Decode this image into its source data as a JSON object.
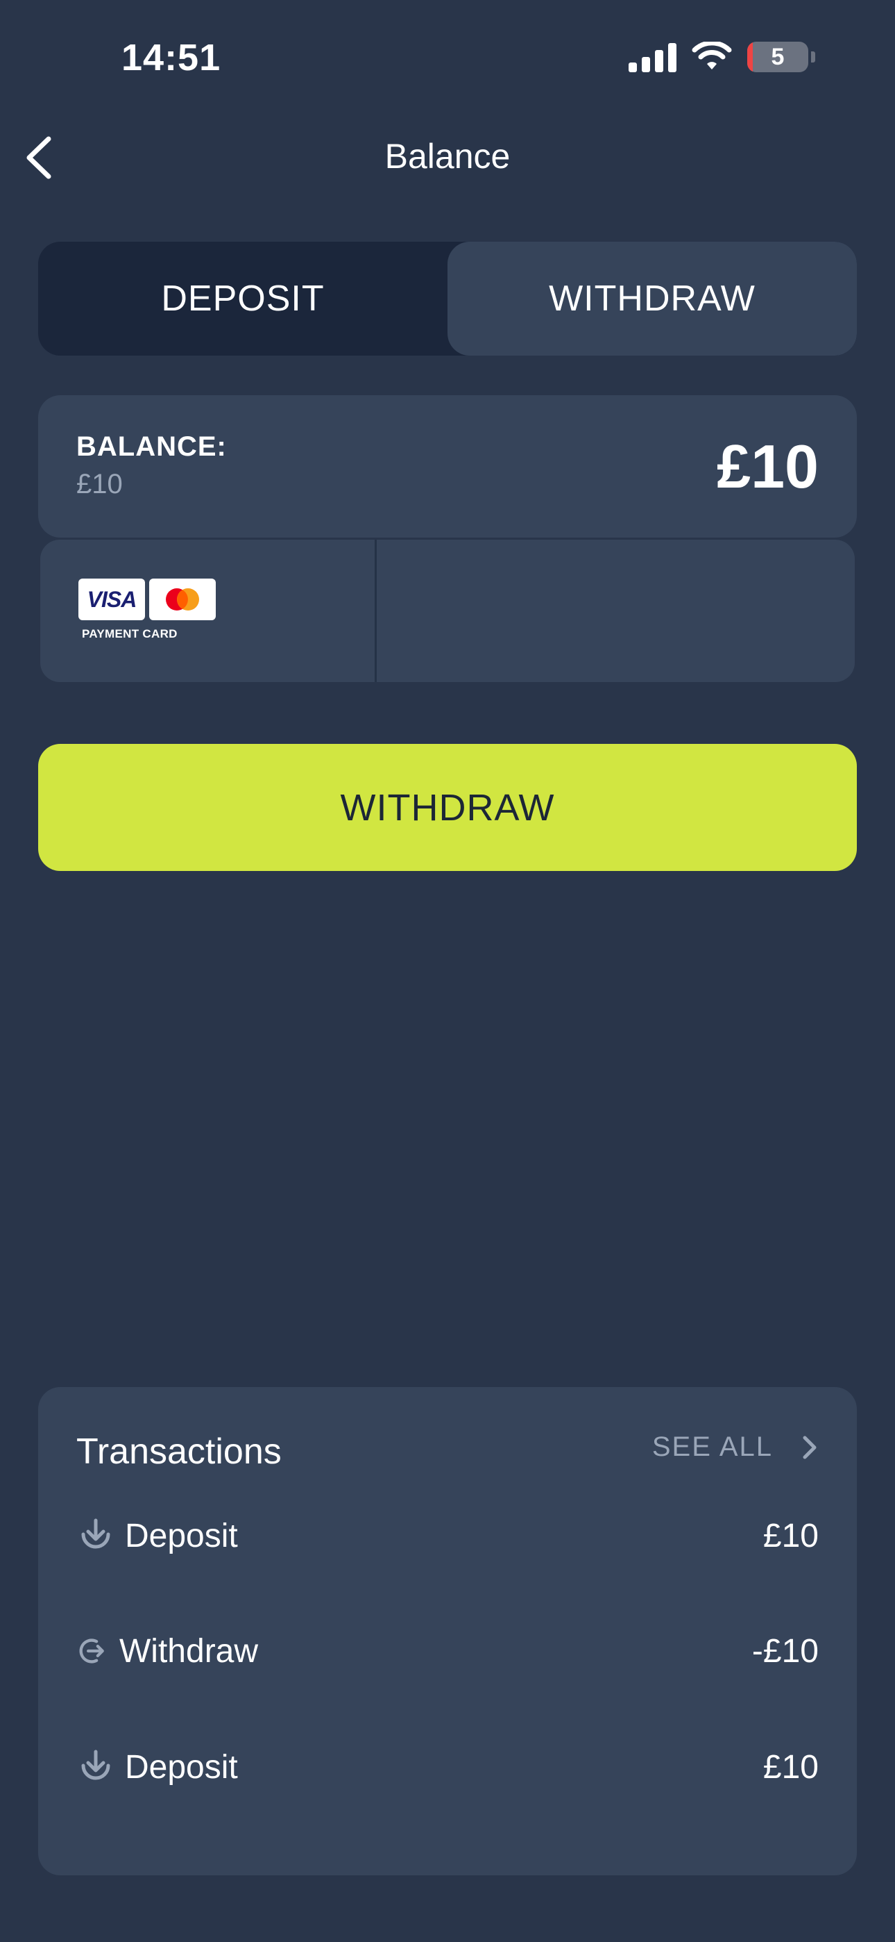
{
  "status_bar": {
    "time": "14:51",
    "battery_level": "5",
    "icons": [
      "signal-icon",
      "wifi-icon",
      "battery-icon"
    ]
  },
  "header": {
    "title": "Balance",
    "back_icon": "chevron-left-icon"
  },
  "tabs": [
    {
      "label": "DEPOSIT",
      "selected": false
    },
    {
      "label": "WITHDRAW",
      "selected": true
    }
  ],
  "balance": {
    "label": "BALANCE:",
    "sub_value": "£10",
    "amount": "£10"
  },
  "payment_method": {
    "brands": [
      "VISA",
      "mastercard"
    ],
    "visa_text": "VISA",
    "caption": "PAYMENT CARD"
  },
  "action": {
    "label": "WITHDRAW"
  },
  "transactions": {
    "title": "Transactions",
    "see_all_label": "SEE ALL",
    "items": [
      {
        "type": "Deposit",
        "icon": "deposit-icon",
        "amount": "£10"
      },
      {
        "type": "Withdraw",
        "icon": "withdraw-icon",
        "amount": "-£10"
      },
      {
        "type": "Deposit",
        "icon": "deposit-icon",
        "amount": "£10"
      }
    ]
  },
  "colors": {
    "background": "#29354a",
    "card": "#36445a",
    "tab_track": "#1b263b",
    "accent": "#d1e641",
    "muted_text": "#9aa6b8"
  }
}
